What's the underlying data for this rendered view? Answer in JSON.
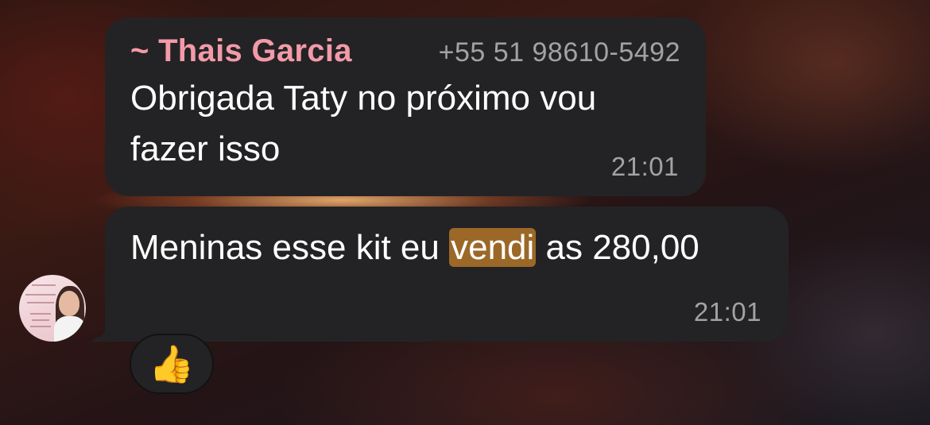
{
  "messages": [
    {
      "sender_name": "~ Thais Garcia",
      "sender_phone": "+55 51 98610-5492",
      "text": "Obrigada Taty no próximo vou fazer isso",
      "time": "21:01"
    },
    {
      "text_before": "Meninas esse kit eu ",
      "text_highlight": "vendi",
      "text_after": " as 280,00",
      "time": "21:01",
      "reaction": "👍"
    }
  ],
  "colors": {
    "bubble": "#232325",
    "sender_name": "#f39aa8",
    "highlight": "#9b6828",
    "meta_text": "#a2a2a6"
  },
  "icons": {
    "avatar": "contact-avatar-photo",
    "reaction": "thumbs-up-emoji"
  }
}
